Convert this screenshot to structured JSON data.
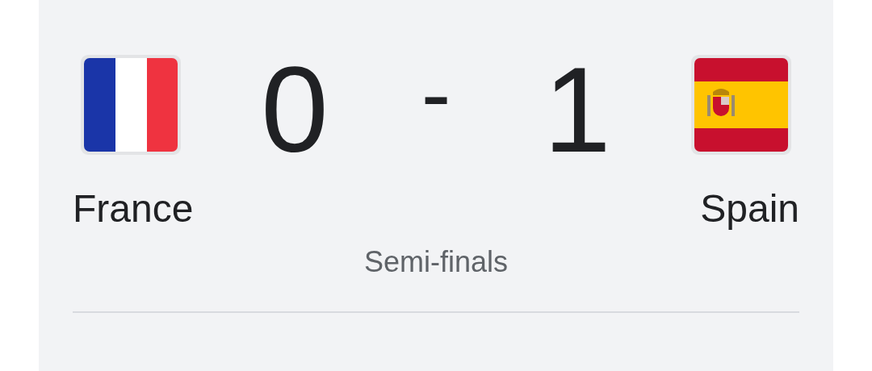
{
  "match": {
    "home": {
      "name": "France",
      "score": "0"
    },
    "separator": "-",
    "away": {
      "name": "Spain",
      "score": "1"
    },
    "stage": "Semi-finals"
  }
}
